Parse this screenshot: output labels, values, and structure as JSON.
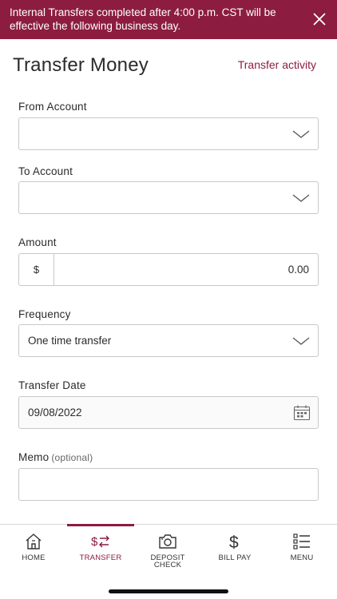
{
  "colors": {
    "brand": "#8c1d40",
    "border": "#c8c8c8",
    "text": "#2b2b2b"
  },
  "banner": {
    "text": "Internal Transfers completed after 4:00 p.m. CST will be effective the following business day.",
    "close_icon": "close-icon"
  },
  "header": {
    "title": "Transfer Money",
    "activity_link": "Transfer activity"
  },
  "form": {
    "from_account": {
      "label": "From Account",
      "value": ""
    },
    "to_account": {
      "label": "To Account",
      "value": ""
    },
    "amount": {
      "label": "Amount",
      "prefix": "$",
      "value": "0.00"
    },
    "frequency": {
      "label": "Frequency",
      "value": "One time transfer"
    },
    "transfer_date": {
      "label": "Transfer Date",
      "value": "09/08/2022"
    },
    "memo": {
      "label": "Memo",
      "optional": "(optional)",
      "value": ""
    }
  },
  "tabs": [
    {
      "label": "HOME",
      "icon": "home-icon",
      "active": false
    },
    {
      "label": "TRANSFER",
      "icon": "transfer-icon",
      "active": true
    },
    {
      "label": "DEPOSIT\nCHECK",
      "icon": "camera-icon",
      "active": false
    },
    {
      "label": "BILL PAY",
      "icon": "dollar-icon",
      "active": false
    },
    {
      "label": "MENU",
      "icon": "menu-icon",
      "active": false
    }
  ]
}
